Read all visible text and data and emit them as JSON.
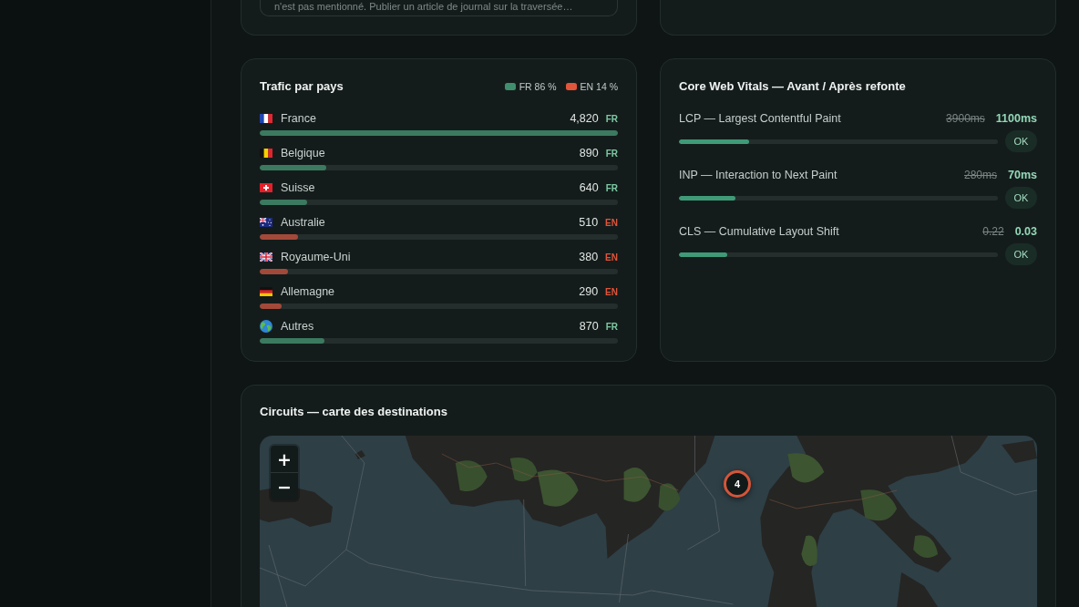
{
  "notes_card": {
    "note": "n'est pas mentionné. Publier un article de journal sur la traversée…"
  },
  "traffic": {
    "title": "Trafic par pays",
    "legend": [
      {
        "label": "FR 86 %",
        "color": "#3f8f6e"
      },
      {
        "label": "EN 14 %",
        "color": "#e1553b"
      }
    ],
    "rows": [
      {
        "country": "France",
        "value": "4,820",
        "lang": "FR",
        "kind": "fr",
        "level": 1
      },
      {
        "country": "Belgique",
        "value": "890",
        "lang": "FR",
        "kind": "fr",
        "level": 0.185
      },
      {
        "country": "Suisse",
        "value": "640",
        "lang": "FR",
        "kind": "fr",
        "level": 0.133
      },
      {
        "country": "Australie",
        "value": "510",
        "lang": "EN",
        "kind": "en",
        "level": 0.106
      },
      {
        "country": "Royaume-Uni",
        "value": "380",
        "lang": "EN",
        "kind": "en",
        "level": 0.079
      },
      {
        "country": "Allemagne",
        "value": "290",
        "lang": "EN",
        "kind": "en",
        "level": 0.06
      },
      {
        "country": "Autres",
        "value": "870",
        "lang": "FR",
        "kind": "fr",
        "level": 0.18
      }
    ]
  },
  "web_vitals": {
    "title": "Core Web Vitals — Avant / Après refonte",
    "metrics": [
      {
        "name": "LCP — Largest Contentful Paint",
        "before": "3900ms",
        "after": "1100ms",
        "level": 0.22,
        "status": "OK"
      },
      {
        "name": "INP — Interaction to Next Paint",
        "before": "280ms",
        "after": "70ms",
        "level": 0.177,
        "status": "OK"
      },
      {
        "name": "CLS — Cumulative Layout Shift",
        "before": "0.22",
        "after": "0.03",
        "level": 0.15,
        "status": "OK"
      }
    ]
  },
  "map": {
    "title": "Circuits — carte des destinations",
    "zoom_in": "+",
    "zoom_out": "−",
    "cluster": "4"
  }
}
